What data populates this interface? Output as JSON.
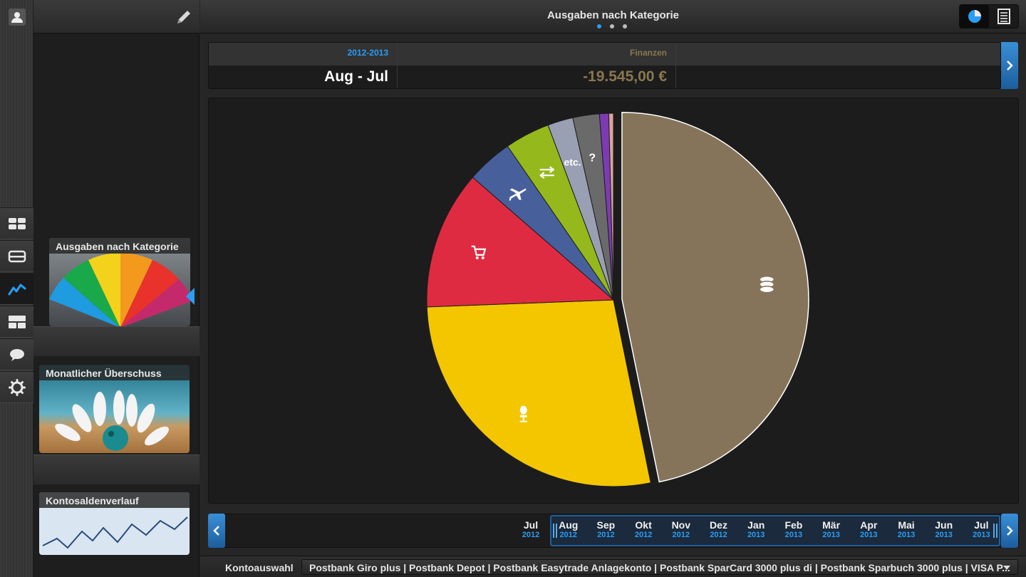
{
  "header": {
    "title": "Ausgaben nach Kategorie",
    "pager_dots": 3,
    "active_dot": 0
  },
  "summary": {
    "period_label": "2012-2013",
    "period_value": "Aug - Jul",
    "category_label": "Finanzen",
    "category_value": "-19.545,00 €"
  },
  "sidebar": {
    "cards": [
      {
        "title": "Ausgaben nach Kategorie"
      },
      {
        "title": "Monatlicher Überschuss"
      },
      {
        "title": "Kontosaldenverlauf"
      }
    ]
  },
  "rail": {
    "items": [
      "dashboard-icon",
      "card-icon",
      "chart-line-icon",
      "layout-icon",
      "chat-icon",
      "gear-icon"
    ],
    "active": "chart-line-icon"
  },
  "chart_data": {
    "type": "pie",
    "title": "",
    "slices": [
      {
        "name": "finance",
        "value": 46.8,
        "color": "#86745a",
        "icon": "database-icon",
        "exploded": true
      },
      {
        "name": "housing",
        "value": 27.6,
        "color": "#f3c600",
        "icon": "chair-icon"
      },
      {
        "name": "shopping",
        "value": 12.0,
        "color": "#df2b42",
        "icon": "cart-icon"
      },
      {
        "name": "travel",
        "value": 4.0,
        "color": "#47609c",
        "icon": "airplane-icon"
      },
      {
        "name": "transfer",
        "value": 3.9,
        "color": "#95b81c",
        "icon": "transfer-icon"
      },
      {
        "name": "etc.",
        "value": 2.2,
        "color": "#9aa0b3",
        "label": "etc."
      },
      {
        "name": "unknown",
        "value": 2.3,
        "color": "#6a6a6a",
        "label": "?"
      },
      {
        "name": "other-1",
        "value": 0.8,
        "color": "#7d3bb3"
      },
      {
        "name": "other-2",
        "value": 0.4,
        "color": "#d9a59b"
      }
    ]
  },
  "timeline": {
    "months": [
      {
        "m": "Jul",
        "y": "2012"
      },
      {
        "m": "Aug",
        "y": "2012"
      },
      {
        "m": "Sep",
        "y": "2012"
      },
      {
        "m": "Okt",
        "y": "2012"
      },
      {
        "m": "Nov",
        "y": "2012"
      },
      {
        "m": "Dez",
        "y": "2012"
      },
      {
        "m": "Jan",
        "y": "2013"
      },
      {
        "m": "Feb",
        "y": "2013"
      },
      {
        "m": "Mär",
        "y": "2013"
      },
      {
        "m": "Apr",
        "y": "2013"
      },
      {
        "m": "Mai",
        "y": "2013"
      },
      {
        "m": "Jun",
        "y": "2013"
      },
      {
        "m": "Jul",
        "y": "2013"
      }
    ],
    "selected_from": 1,
    "selected_to": 12
  },
  "footer": {
    "account_label": "Kontoauswahl",
    "account_value": "Postbank Giro plus | Postbank Depot | Postbank Easytrade Anlagekonto | Postbank SparCard 3000 plus di | Postbank Sparbuch 3000 plus | VISA P..."
  },
  "colors": {
    "accent": "#2a9df4",
    "finance_value": "#8a7750"
  }
}
